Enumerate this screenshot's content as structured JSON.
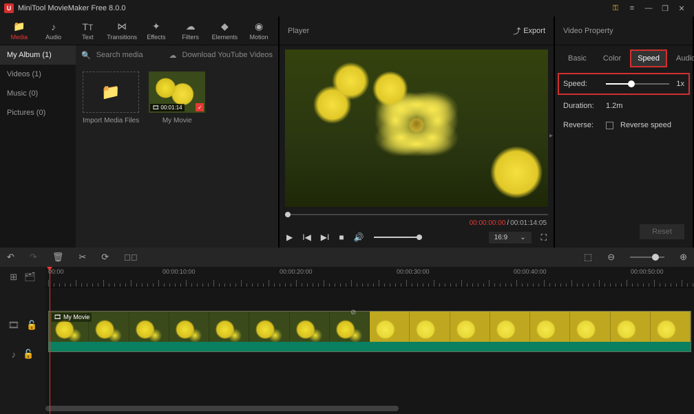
{
  "titlebar": {
    "app_name": "MiniTool MovieMaker Free 8.0.0"
  },
  "tabs": {
    "media": "Media",
    "audio": "Audio",
    "text": "Text",
    "transitions": "Transitions",
    "effects": "Effects",
    "filters": "Filters",
    "elements": "Elements",
    "motion": "Motion"
  },
  "album": {
    "my_album": "My Album (1)",
    "videos": "Videos (1)",
    "music": "Music (0)",
    "pictures": "Pictures (0)"
  },
  "media": {
    "search_placeholder": "Search media",
    "download_yt": "Download YouTube Videos",
    "import_label": "Import Media Files",
    "clip_duration": "00:01:14",
    "clip_name": "My Movie"
  },
  "player": {
    "title": "Player",
    "export": "Export",
    "time_current": "00:00:00:00",
    "time_sep": " / ",
    "time_total": "00:01:14:05",
    "aspect": "16:9"
  },
  "props": {
    "title": "Video Property",
    "tabs": {
      "basic": "Basic",
      "color": "Color",
      "speed": "Speed",
      "audio": "Audio"
    },
    "speed_label": "Speed:",
    "speed_value": "1x",
    "duration_label": "Duration:",
    "duration_value": "1.2m",
    "reverse_label": "Reverse:",
    "reverse_chk": "Reverse speed",
    "reset": "Reset"
  },
  "timeline": {
    "marks": [
      "00:00",
      "00:00:10:00",
      "00:00:20:00",
      "00:00:30:00",
      "00:00:40:00",
      "00:00:50:00"
    ],
    "clip_label": "My Movie"
  }
}
